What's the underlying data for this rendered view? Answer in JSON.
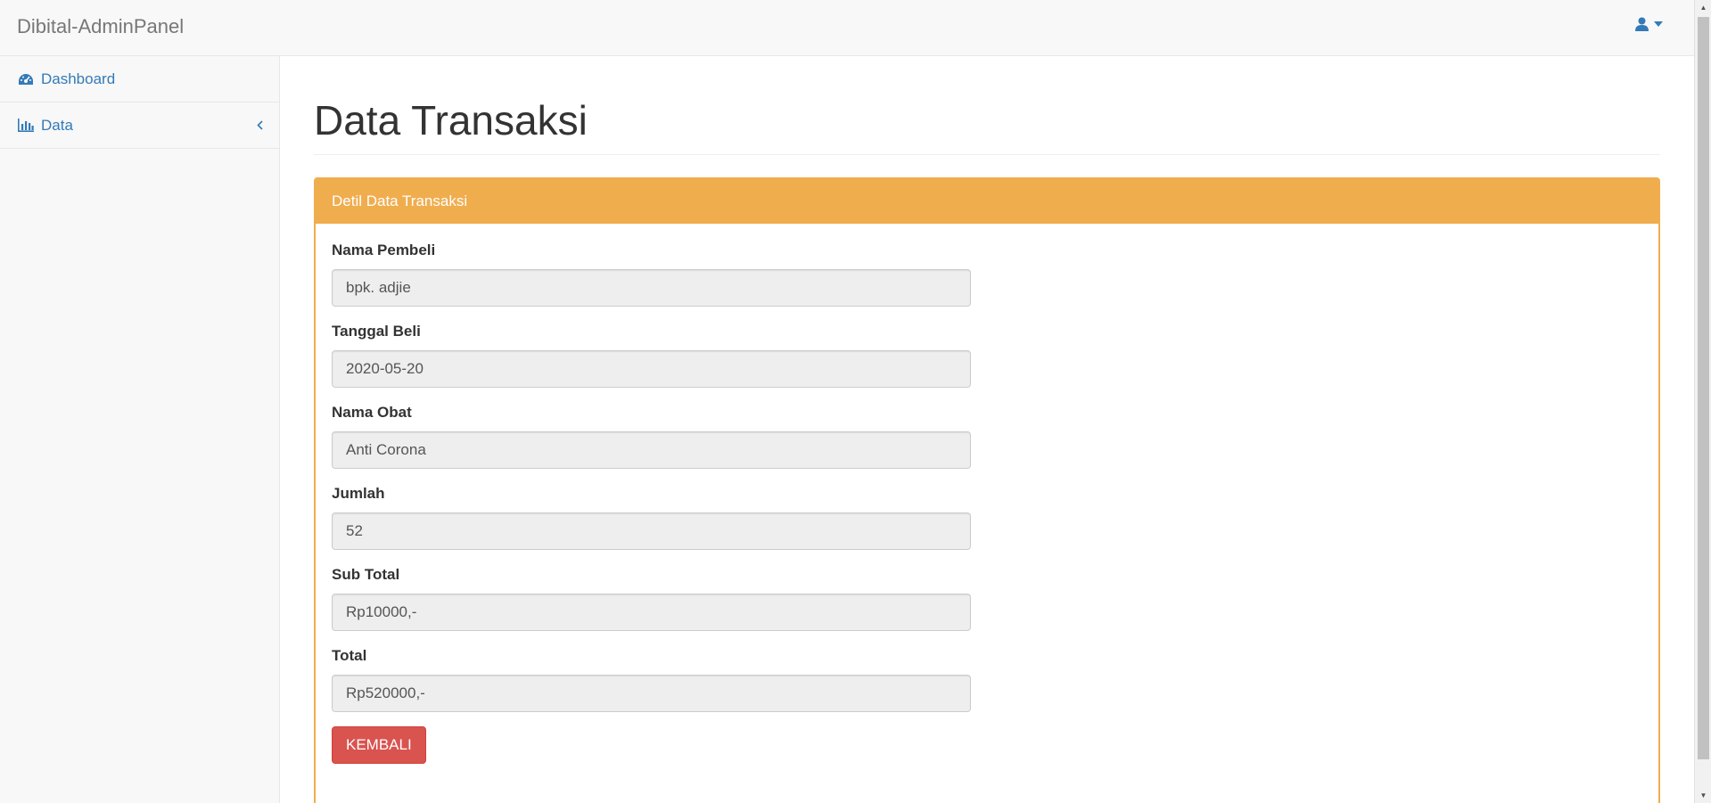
{
  "navbar": {
    "brand": "Dibital-AdminPanel",
    "user_icon": "user-icon",
    "caret_icon": "caret-down-icon"
  },
  "sidebar": {
    "items": [
      {
        "label": "Dashboard",
        "icon": "dashboard-icon"
      },
      {
        "label": "Data",
        "icon": "bar-chart-icon",
        "chevron": "chevron-left-icon"
      }
    ]
  },
  "main": {
    "page_title": "Data Transaksi",
    "panel": {
      "heading": "Detil Data Transaksi",
      "fields": [
        {
          "label": "Nama Pembeli",
          "value": "bpk. adjie"
        },
        {
          "label": "Tanggal Beli",
          "value": "2020-05-20"
        },
        {
          "label": "Nama Obat",
          "value": "Anti Corona"
        },
        {
          "label": "Jumlah",
          "value": "52"
        },
        {
          "label": "Sub Total",
          "value": "Rp10000,-"
        },
        {
          "label": "Total",
          "value": "Rp520000,-"
        }
      ],
      "back_button": "KEMBALI"
    }
  },
  "colors": {
    "primary": "#337ab7",
    "warning": "#f0ad4e",
    "danger": "#d9534f"
  }
}
